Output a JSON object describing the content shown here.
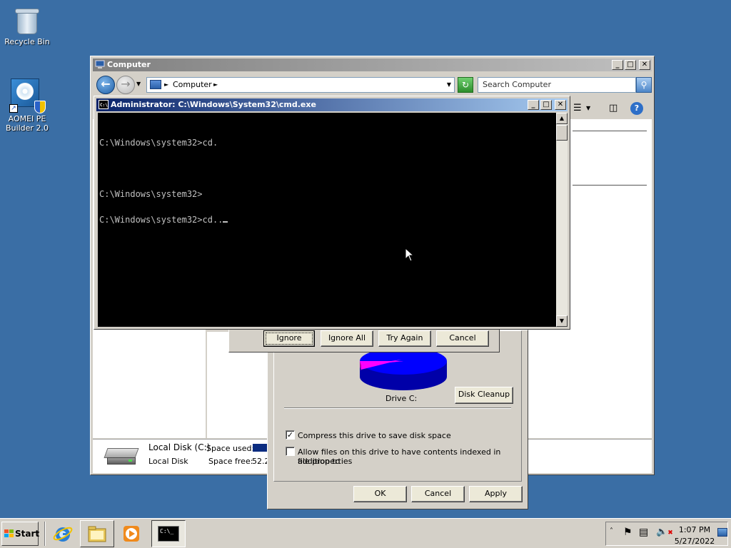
{
  "desktop": {
    "icons": [
      {
        "label": "Recycle Bin"
      },
      {
        "label": "AOMEI PE Builder 2.0"
      }
    ]
  },
  "explorer": {
    "title": "Computer",
    "address": {
      "crumb": "Computer"
    },
    "search_placeholder": "Search Computer",
    "details": {
      "drive_name": "Local Disk (C:)",
      "drive_type": "Local Disk",
      "space_used_label": "Space used:",
      "space_free_label": "Space free:",
      "space_free_value": "52.2"
    }
  },
  "cmd": {
    "title": "Administrator: C:\\Windows\\System32\\cmd.exe",
    "lines": [
      "C:\\Windows\\system32>cd.",
      "",
      "C:\\Windows\\system32>",
      "C:\\Windows\\system32>cd.."
    ]
  },
  "error_dialog": {
    "ignore": "Ignore",
    "ignore_all": "Ignore All",
    "try_again": "Try Again",
    "cancel": "Cancel"
  },
  "properties": {
    "drive_label": "Drive C:",
    "disk_cleanup": "Disk Cleanup",
    "compress_label": "Compress this drive to save disk space",
    "compress_checked": true,
    "index_label_1": "Allow files on this drive to have contents indexed in addition to",
    "index_label_2": "file properties",
    "index_checked": false,
    "ok": "OK",
    "cancel": "Cancel",
    "apply": "Apply",
    "colors": {
      "used": "#ff00ff",
      "free": "#0000ff"
    }
  },
  "taskbar": {
    "start_label": "Start",
    "time": "1:07 PM",
    "date": "5/27/2022"
  }
}
